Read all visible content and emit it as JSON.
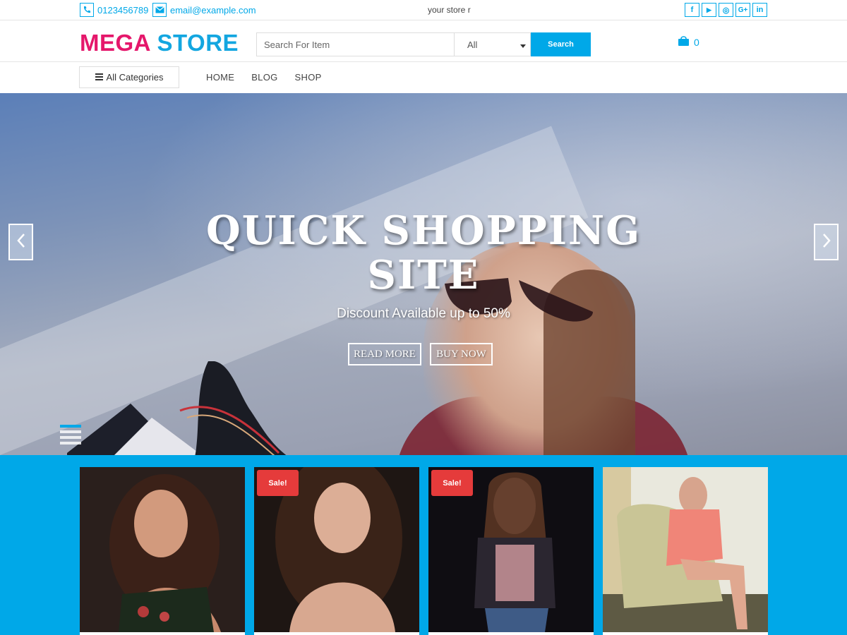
{
  "topbar": {
    "phone": "0123456789",
    "email": "email@example.com",
    "tagline": "your store r",
    "social": [
      {
        "icon": "facebook-icon",
        "glyph": "f"
      },
      {
        "icon": "youtube-icon",
        "glyph": "▶"
      },
      {
        "icon": "instagram-icon",
        "glyph": "◎"
      },
      {
        "icon": "google-plus-icon",
        "glyph": "G+"
      },
      {
        "icon": "linkedin-icon",
        "glyph": "in"
      }
    ]
  },
  "header": {
    "logo_part1": "MEGA",
    "logo_part2": "STORE",
    "search_placeholder": "Search For Item",
    "category_selected": "All",
    "search_button": "Search",
    "cart_count": "0"
  },
  "nav": {
    "all_categories": "All Categories",
    "items": [
      "HOME",
      "BLOG",
      "SHOP"
    ]
  },
  "hero": {
    "title_line1": "QUICK SHOPPING",
    "title_line2": "SITE",
    "subtitle": "Discount Available up to 50%",
    "read_more": "READ MORE",
    "buy_now": "BUY NOW"
  },
  "products": [
    {
      "sale": false,
      "sale_label": ""
    },
    {
      "sale": true,
      "sale_label": "Sale!"
    },
    {
      "sale": true,
      "sale_label": "Sale!"
    },
    {
      "sale": false,
      "sale_label": ""
    }
  ],
  "colors": {
    "accent": "#00a8e8",
    "logo_pink": "#e5176b",
    "logo_blue": "#13a6e0",
    "sale_red": "#e53b3b"
  }
}
